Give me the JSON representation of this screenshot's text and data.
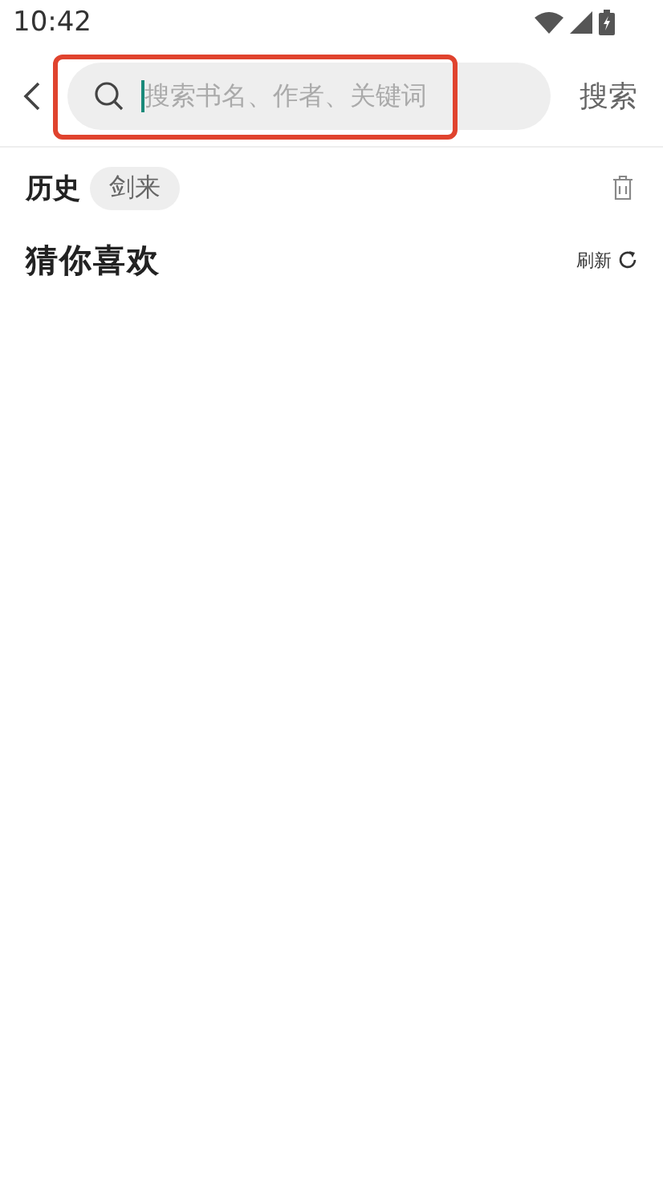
{
  "status_bar": {
    "time": "10:42"
  },
  "search": {
    "placeholder": "搜索书名、作者、关键词",
    "focused": true,
    "highlighted": true,
    "button": "搜索"
  },
  "history": {
    "title": "历史",
    "items": [
      "剑来"
    ]
  },
  "recommend": {
    "title": "猜你喜欢",
    "refresh": "刷新"
  }
}
